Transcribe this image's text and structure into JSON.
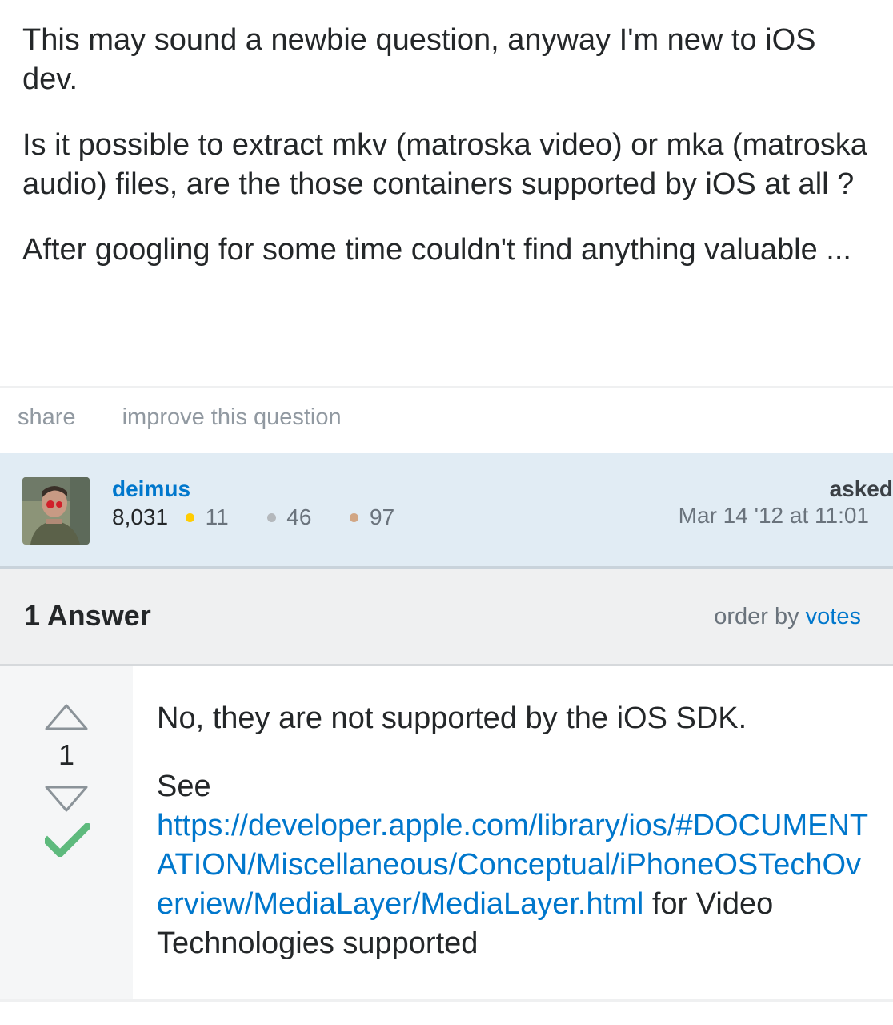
{
  "question": {
    "paragraphs": [
      "This may sound a newbie question, anyway I'm new to iOS dev.",
      "Is it possible to extract mkv (matroska video) or mka (matroska audio) files, are the those containers supported by iOS at all ?",
      "After googling for some time couldn't find anything valuable ..."
    ],
    "actions": {
      "share": "share",
      "improve": "improve this question"
    },
    "owner": {
      "name": "deimus",
      "reputation": "8,031",
      "gold": "11",
      "silver": "46",
      "bronze": "97",
      "asked_label": "asked",
      "asked_time": "Mar 14 '12 at 11:01"
    }
  },
  "answers_header": {
    "count_label": "1 Answer",
    "order_prefix": "order by",
    "order_value": "votes"
  },
  "answer": {
    "vote_count": "1",
    "text_1": "No, they are not supported by the iOS SDK.",
    "see": "See",
    "link": "https://developer.apple.com/library/ios/#DOCUMENTATION/Miscellaneous/Conceptual/iPhoneOSTechOverview/MediaLayer/MediaLayer.html",
    "after_link": " for Video Technologies supported"
  },
  "colors": {
    "link": "#0077cc",
    "owner_bg": "#e1ecf4",
    "accepted": "#5eba7d"
  }
}
